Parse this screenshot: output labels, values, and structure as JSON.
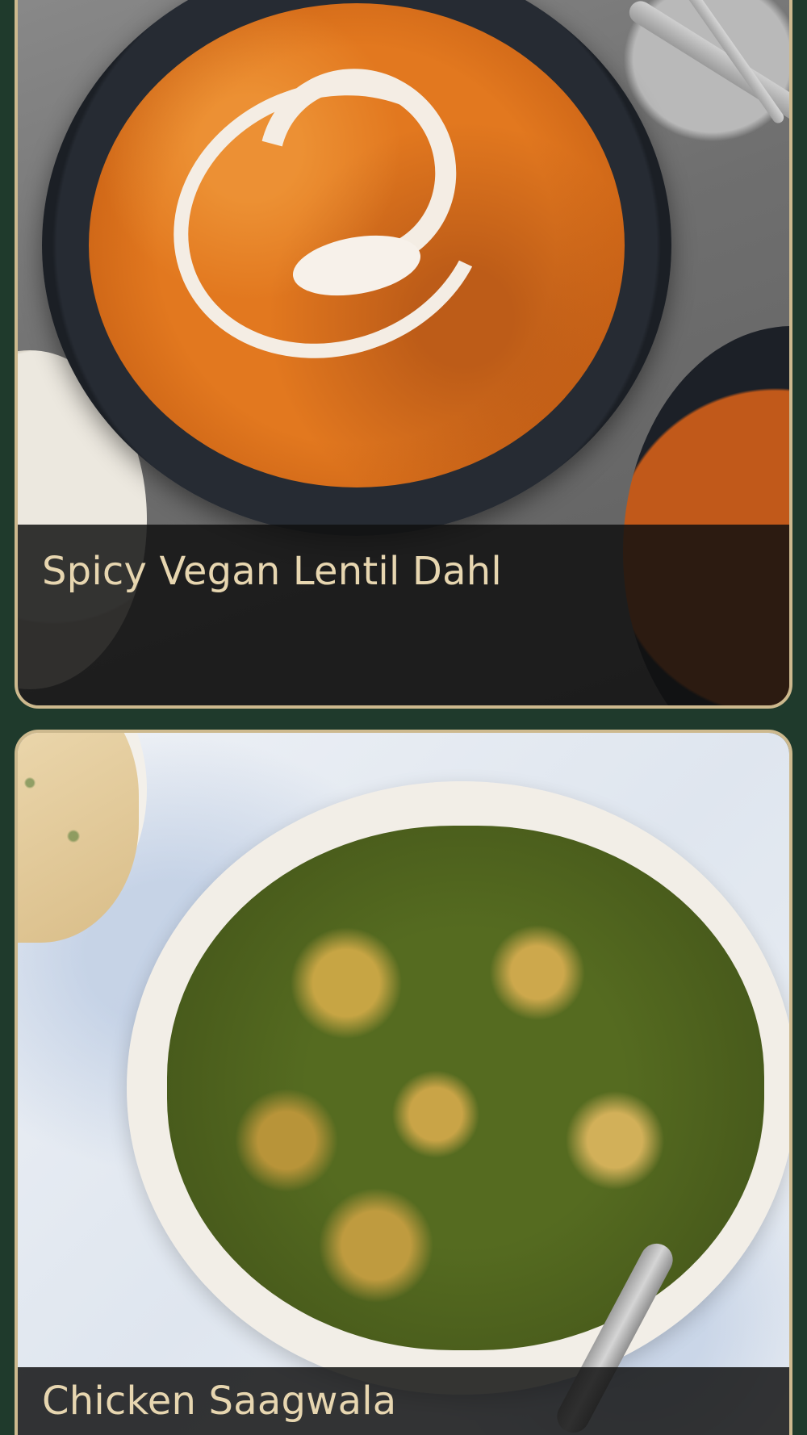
{
  "recipes": [
    {
      "title": "Spicy Vegan Lentil Dahl",
      "photo": "lentil-dahl-photo"
    },
    {
      "title": "Chicken Saagwala",
      "photo": "chicken-saagwala-photo"
    }
  ],
  "colors": {
    "background": "#1f3a2c",
    "card_border": "#cdb98e",
    "caption_text": "#e7d6b0",
    "caption_bar": "#0f0f0f"
  }
}
